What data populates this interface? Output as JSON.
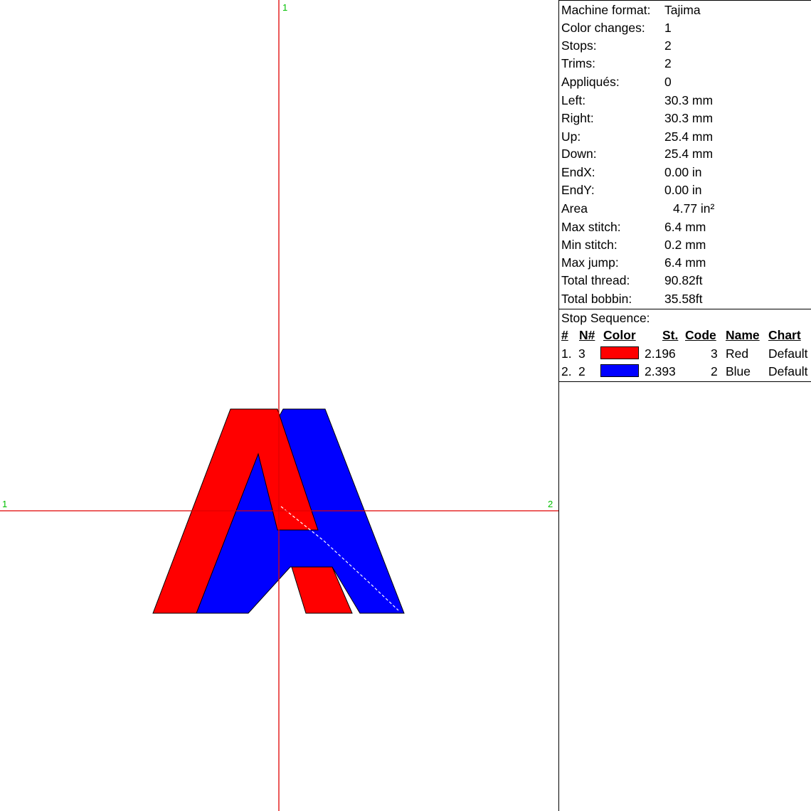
{
  "stats": [
    {
      "label": "Machine format:",
      "value": "Tajima"
    },
    {
      "label": "Color changes:",
      "value": "1"
    },
    {
      "label": "Stops:",
      "value": "2"
    },
    {
      "label": "Trims:",
      "value": "2"
    },
    {
      "label": "Appliqués:",
      "value": "0"
    },
    {
      "label": "Left:",
      "value": "30.3 mm"
    },
    {
      "label": "Right:",
      "value": "30.3 mm"
    },
    {
      "label": "Up:",
      "value": "25.4 mm"
    },
    {
      "label": "Down:",
      "value": "25.4 mm"
    },
    {
      "label": "EndX:",
      "value": "0.00 in"
    },
    {
      "label": "EndY:",
      "value": "0.00 in"
    },
    {
      "label": "Area",
      "value": "4.77 in²"
    },
    {
      "label": "Max stitch:",
      "value": "6.4 mm"
    },
    {
      "label": "Min stitch:",
      "value": "0.2 mm"
    },
    {
      "label": "Max jump:",
      "value": "6.4 mm"
    },
    {
      "label": "Total thread:",
      "value": "90.82ft"
    },
    {
      "label": "Total bobbin:",
      "value": "35.58ft"
    }
  ],
  "stop_sequence": {
    "title": "Stop Sequence:",
    "headers": {
      "num": "#",
      "n": "N#",
      "color": "Color",
      "st": "St.",
      "code": "Code",
      "name": "Name",
      "chart": "Chart"
    },
    "rows": [
      {
        "num": "1.",
        "n": "3",
        "color": "#ff0000",
        "st": "2.196",
        "code": "3",
        "name": "Red",
        "chart": "Default"
      },
      {
        "num": "2.",
        "n": "2",
        "color": "#0000ff",
        "st": "2.393",
        "code": "2",
        "name": "Blue",
        "chart": "Default"
      }
    ]
  },
  "preview": {
    "axis_color": "#e00000",
    "marker_color": "#00c000",
    "markers": {
      "top": "1",
      "left": "1",
      "right": "2"
    },
    "thread_colors": [
      "#ff0000",
      "#0000ff"
    ]
  }
}
